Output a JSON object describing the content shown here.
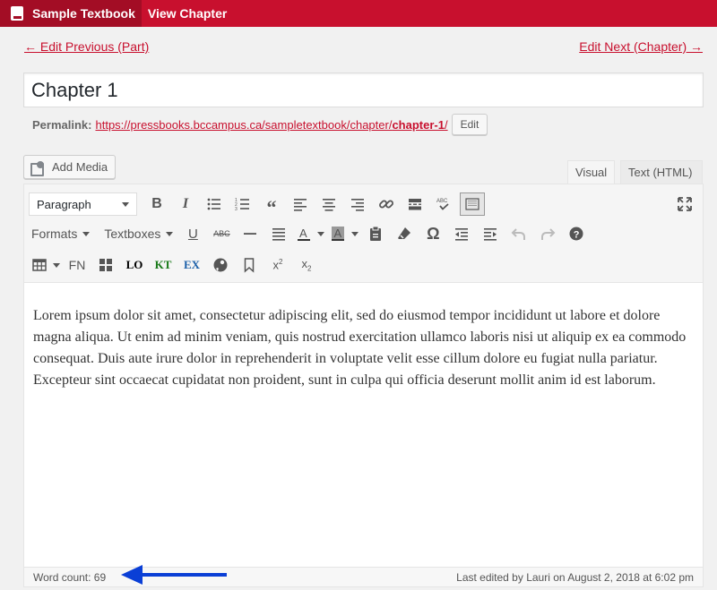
{
  "adminbar": {
    "site_title": "Sample Textbook",
    "view_label": "View Chapter"
  },
  "nav": {
    "prev": "← Edit Previous (Part)",
    "next": "Edit Next (Chapter) →"
  },
  "post": {
    "title": "Chapter 1",
    "permalink_label": "Permalink:",
    "permalink_base": "https://pressbooks.bccampus.ca/sampletextbook/chapter/",
    "permalink_slug": "chapter-1",
    "permalink_trail": "/",
    "edit_label": "Edit"
  },
  "editor": {
    "add_media": "Add Media",
    "tab_visual": "Visual",
    "tab_text": "Text (HTML)",
    "format_select": "Paragraph",
    "formats_menu": "Formats",
    "textboxes_menu": "Textboxes",
    "fn_label": "FN",
    "lo_label": "LO",
    "kt_label": "KT",
    "ex_label": "EX",
    "body": "Lorem ipsum dolor sit amet, consectetur adipiscing elit, sed do eiusmod tempor incididunt ut labore et dolore magna aliqua. Ut enim ad minim veniam, quis nostrud exercitation ullamco laboris nisi ut aliquip ex ea commodo consequat. Duis aute irure dolor in reprehenderit in voluptate velit esse cillum dolore eu fugiat nulla pariatur. Excepteur sint occaecat cupidatat non proident, sunt in culpa qui officia deserunt mollit anim id est laborum.",
    "word_count": "Word count: 69",
    "last_edited": "Last edited by Lauri on August 2, 2018 at 6:02 pm"
  },
  "colors": {
    "brand": "#c8102e",
    "brand_dark": "#a30d25",
    "annotation_arrow": "#0a3fd6",
    "kt_green": "#1a7a1a",
    "ex_blue": "#1a5fa8"
  }
}
